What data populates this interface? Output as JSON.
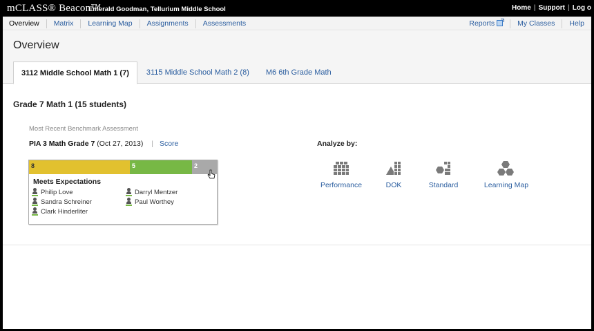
{
  "topbar": {
    "brand": "mCLASS® Beacon™",
    "user": "Emerald Goodman, Tellurium Middle School",
    "links": [
      "Home",
      "Support",
      "Log o"
    ]
  },
  "nav": {
    "left": [
      "Overview",
      "Matrix",
      "Learning Map",
      "Assignments",
      "Assessments"
    ],
    "reports": "Reports",
    "my_classes": "My Classes",
    "help": "Help"
  },
  "page": {
    "title": "Overview",
    "tabs": [
      {
        "label": "3112 Middle School Math 1 (7)",
        "active": true
      },
      {
        "label": "3115 Middle School Math 2 (8)",
        "active": false
      },
      {
        "label": "M6 6th Grade Math",
        "active": false
      }
    ]
  },
  "class_section": {
    "title": "Grade 7 Math 1 (15 students)",
    "benchmark_label": "Most Recent Benchmark Assessment",
    "assessment_name": "PIA 3 Math Grade 7",
    "assessment_date": "(Oct 27, 2013)",
    "score_link": "Score"
  },
  "score_bar": {
    "segments": [
      {
        "count": "8",
        "color": "#e2c12f"
      },
      {
        "count": "5",
        "color": "#77b845"
      },
      {
        "count": "2",
        "color": "#a9a9a9"
      }
    ],
    "category": "Meets Expectations",
    "students": [
      "Philip Love",
      "Darryl Mentzer",
      "Sandra Schreiner",
      "Paul Worthey",
      "Clark Hinderliter"
    ]
  },
  "analyze": {
    "label": "Analyze by:",
    "options": [
      {
        "label": "Performance",
        "icon": "performance-grid-icon"
      },
      {
        "label": "DOK",
        "icon": "dok-icon"
      },
      {
        "label": "Standard",
        "icon": "standard-hex-icon"
      },
      {
        "label": "Learning Map",
        "icon": "learning-map-hex-icon"
      }
    ]
  }
}
